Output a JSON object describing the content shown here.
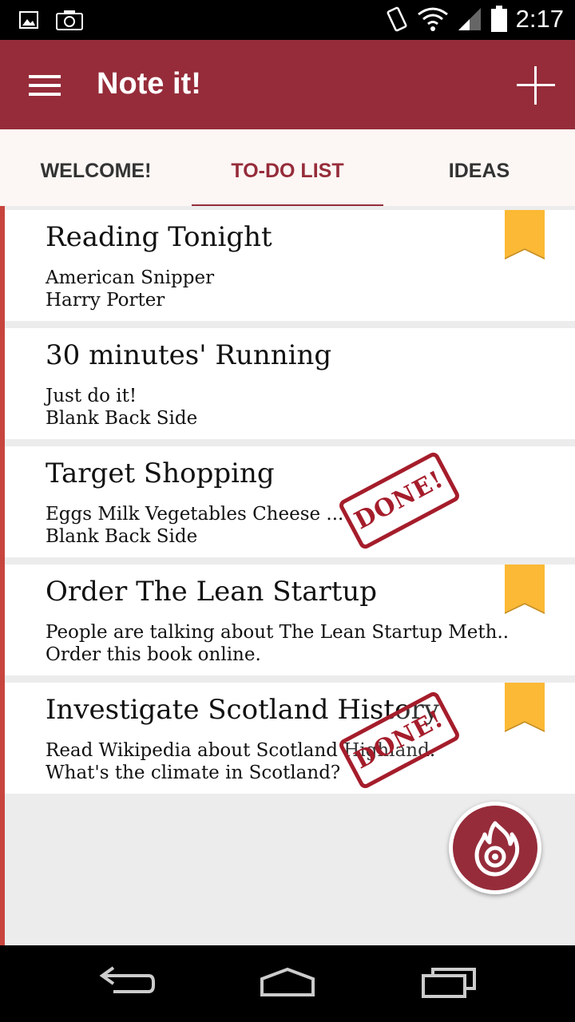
{
  "status_bar": {
    "time": "2:17"
  },
  "app_bar": {
    "title": "Note it!"
  },
  "tabs": [
    {
      "label": "WELCOME!",
      "active": false
    },
    {
      "label": "TO-DO LIST",
      "active": true
    },
    {
      "label": "IDEAS",
      "active": false
    }
  ],
  "notes": [
    {
      "title": "Reading Tonight",
      "line1": "American Snipper",
      "line2": "Harry Porter",
      "bookmarked": true,
      "done": false
    },
    {
      "title": "30 minutes' Running",
      "line1": "Just do it!",
      "line2": "Blank Back Side",
      "bookmarked": false,
      "done": false
    },
    {
      "title": "Target Shopping",
      "line1": "Eggs Milk Vegetables Cheese ...",
      "line2": "Blank Back Side",
      "bookmarked": false,
      "done": true
    },
    {
      "title": "Order The Lean Startup",
      "line1": "People are talking about The Lean Startup Meth..",
      "line2": "Order this book online.",
      "bookmarked": true,
      "done": false
    },
    {
      "title": "Investigate Scotland History",
      "line1": "Read Wikipedia about Scotland Highland.",
      "line2": "What's the climate in Scotland?",
      "bookmarked": true,
      "done": true
    }
  ],
  "stamp_text": "DONE!",
  "colors": {
    "primary": "#962c3a",
    "bookmark": "#fbb935",
    "rail": "#c8453e",
    "stamp": "#a51d2b"
  },
  "icons": {
    "menu": "hamburger-icon",
    "add": "plus-icon",
    "fab": "flame-icon",
    "back": "back-icon",
    "home": "home-icon",
    "recents": "recents-icon"
  }
}
